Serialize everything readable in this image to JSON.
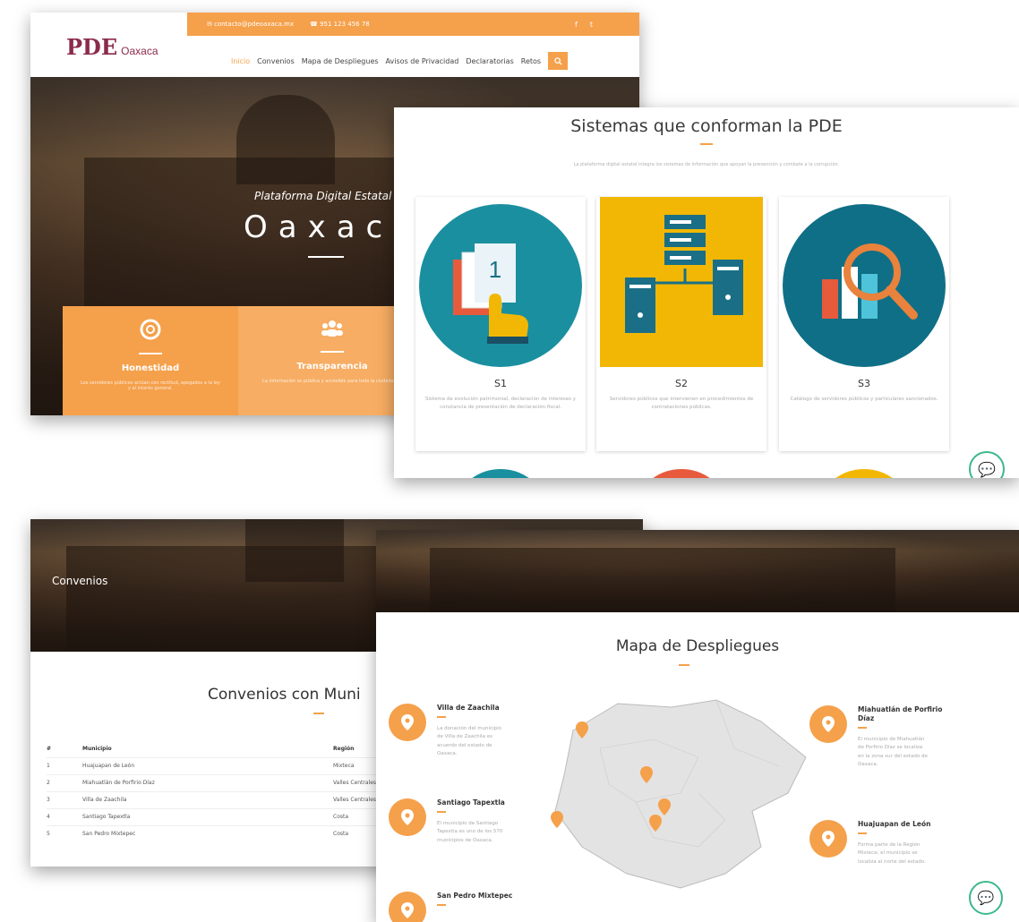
{
  "home": {
    "topbar": {
      "email": "contacto@pdeoaxaca.mx",
      "phone": "951 123 456 78",
      "social": [
        "f",
        "t"
      ]
    },
    "logo": {
      "mark": "PDE",
      "text": "Oaxaca"
    },
    "menu": [
      "Inicio",
      "Convenios",
      "Mapa de Despliegues",
      "Avisos de Privacidad",
      "Declaratorias",
      "Retos"
    ],
    "hero": {
      "subtitle": "Plataforma Digital Estatal",
      "title": "Oaxaca"
    },
    "values": [
      {
        "title": "Honestidad",
        "text": "Los servidores públicos actúan con rectitud, apegados a la ley y al interés general."
      },
      {
        "title": "Transparencia",
        "text": "La información es pública y accesible para toda la ciudadanía."
      }
    ],
    "accent_color": "#f5a04b"
  },
  "sistemas": {
    "title": "Sistemas que conforman la PDE",
    "description": "La plataforma digital estatal integra los sistemas de información que apoyan la prevención y combate a la corrupción.",
    "cards": [
      {
        "title": "S1",
        "desc": "Sistema de evolución patrimonial, declaración de intereses y constancia de presentación de declaración fiscal.",
        "color": "#1a8fa0",
        "icon": "documents-hand-icon"
      },
      {
        "title": "S2",
        "desc": "Servidores públicos que intervienen en procedimientos de contrataciones públicas.",
        "color": "#f2b705",
        "icon": "servers-icon"
      },
      {
        "title": "S3",
        "desc": "Catálogo de servidores públicos y particulares sancionados.",
        "color": "#0f6f86",
        "icon": "search-chart-icon"
      }
    ]
  },
  "convenios": {
    "banner_title": "Convenios",
    "title": "Convenios con Muni",
    "table": {
      "headers": [
        "#",
        "Municipio",
        "Región"
      ],
      "rows": [
        [
          "1",
          "Huajuapan de León",
          "Mixteca"
        ],
        [
          "2",
          "Miahuatlán de Porfirio Díaz",
          "Valles Centrales"
        ],
        [
          "3",
          "Villa de Zaachila",
          "Valles Centrales"
        ],
        [
          "4",
          "Santiago Tapextla",
          "Costa"
        ],
        [
          "5",
          "San Pedro Mixtepec",
          "Costa"
        ]
      ]
    }
  },
  "mapa": {
    "title": "Mapa de Despliegues",
    "locations": [
      {
        "name": "Villa de Zaachila",
        "desc": "La donación del municipio de Villa de Zaachila es acuerdo del estado de Oaxaca."
      },
      {
        "name": "Santiago Tapextla",
        "desc": "El municipio de Santiago Tapextla es uno de los 570 municipios de Oaxaca."
      },
      {
        "name": "San Pedro Mixtepec",
        "desc": ""
      },
      {
        "name": "Miahuatlán de Porfirio Díaz",
        "desc": "El municipio de Miahuatlán de Porfirio Díaz se localiza en la zona sur del estado de Oaxaca."
      },
      {
        "name": "Huajuapan de León",
        "desc": "Forma parte de la Región Mixteca; el municipio se localiza al norte del estado."
      }
    ]
  }
}
